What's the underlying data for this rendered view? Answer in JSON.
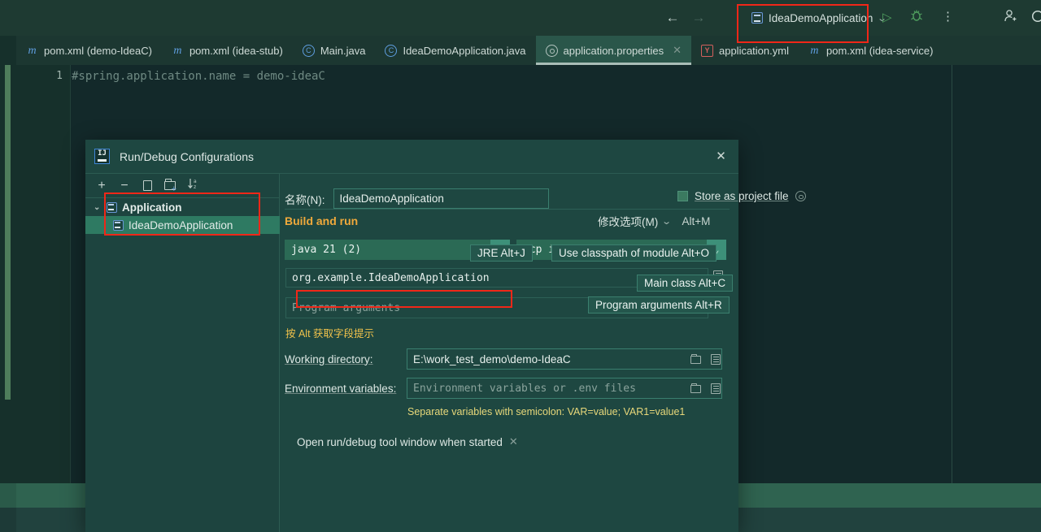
{
  "topbar": {
    "back_icon": "arrow-left-icon",
    "forward_icon": "arrow-right-icon",
    "run_config_name": "IdeaDemoApplication",
    "run_config_chevron": "⌄",
    "run_label": "▷",
    "more_label": "⋮"
  },
  "tabs": [
    {
      "label": "pom.xml (demo-IdeaC)",
      "icon": "maven-icon",
      "icon_glyph": "m",
      "active": false,
      "closable": false
    },
    {
      "label": "pom.xml (idea-stub)",
      "icon": "maven-icon",
      "icon_glyph": "m",
      "active": false,
      "closable": false
    },
    {
      "label": "Main.java",
      "icon": "java-class-icon",
      "icon_glyph": "C",
      "active": false,
      "closable": false
    },
    {
      "label": "IdeaDemoApplication.java",
      "icon": "java-class-icon",
      "icon_glyph": "C",
      "active": false,
      "closable": false
    },
    {
      "label": "application.properties",
      "icon": "properties-icon",
      "icon_glyph": "",
      "active": true,
      "closable": true
    },
    {
      "label": "application.yml",
      "icon": "yaml-icon",
      "icon_glyph": "Y",
      "active": false,
      "closable": false
    },
    {
      "label": "pom.xml (idea-service)",
      "icon": "maven-icon",
      "icon_glyph": "m",
      "active": false,
      "closable": false
    }
  ],
  "editor": {
    "line_number": "1",
    "line_text": "#spring.application.name = demo-ideaC"
  },
  "dialog": {
    "title": "Run/Debug Configurations",
    "close_label": "✕",
    "toolbar": {
      "add_label": "+",
      "remove_label": "−",
      "copy_label": "copy-configuration-icon",
      "folder_label": "new-folder-icon",
      "sort_label": "↓ᵃ₂"
    },
    "tree": {
      "group_label": "Application",
      "group_chevron": "⌄",
      "child_label": "IdeaDemoApplication"
    },
    "name_field": {
      "label": "名称(N):",
      "label_mnemonic": "N",
      "value": "IdeaDemoApplication"
    },
    "store_as_project_file": {
      "label": "Store as project file",
      "checked": false,
      "gear_icon": "gear-icon"
    },
    "section_build_and_run": "Build and run",
    "modify_options": {
      "label": "修改选项(M)",
      "chevron": "⌄",
      "shortcut": "Alt+M"
    },
    "jre_combo": {
      "value": "java 21 (2)",
      "arrow": "⌄"
    },
    "module_combo": {
      "value": "-cp idea-service",
      "arrow": "⌄"
    },
    "main_class_field": {
      "value": "org.example.IdeaDemoApplication"
    },
    "program_arguments_field": {
      "placeholder": "Program arguments"
    },
    "alt_hint": "按 Alt 获取字段提示",
    "working_directory": {
      "label": "Working directory:",
      "label_mnemonic": "W",
      "value": "E:\\work_test_demo\\demo-IdeaC"
    },
    "environment_variables": {
      "label": "Environment variables:",
      "label_mnemonic": "E",
      "placeholder": "Environment variables or .env files"
    },
    "env_note": "Separate variables with semicolon: VAR=value; VAR1=value1",
    "open_tool_window": {
      "label": "Open run/debug tool window when started",
      "remove_label": "✕"
    },
    "tooltips": [
      {
        "text": "JRE Alt+J"
      },
      {
        "text": "Use classpath of module Alt+O"
      },
      {
        "text": "Main class Alt+C"
      },
      {
        "text": "Program arguments Alt+R"
      }
    ]
  },
  "colors": {
    "accent_green": "#2e7a62",
    "highlight_red": "#f02718",
    "section_orange": "#f0a93b",
    "note_yellow": "#e8d87a"
  }
}
